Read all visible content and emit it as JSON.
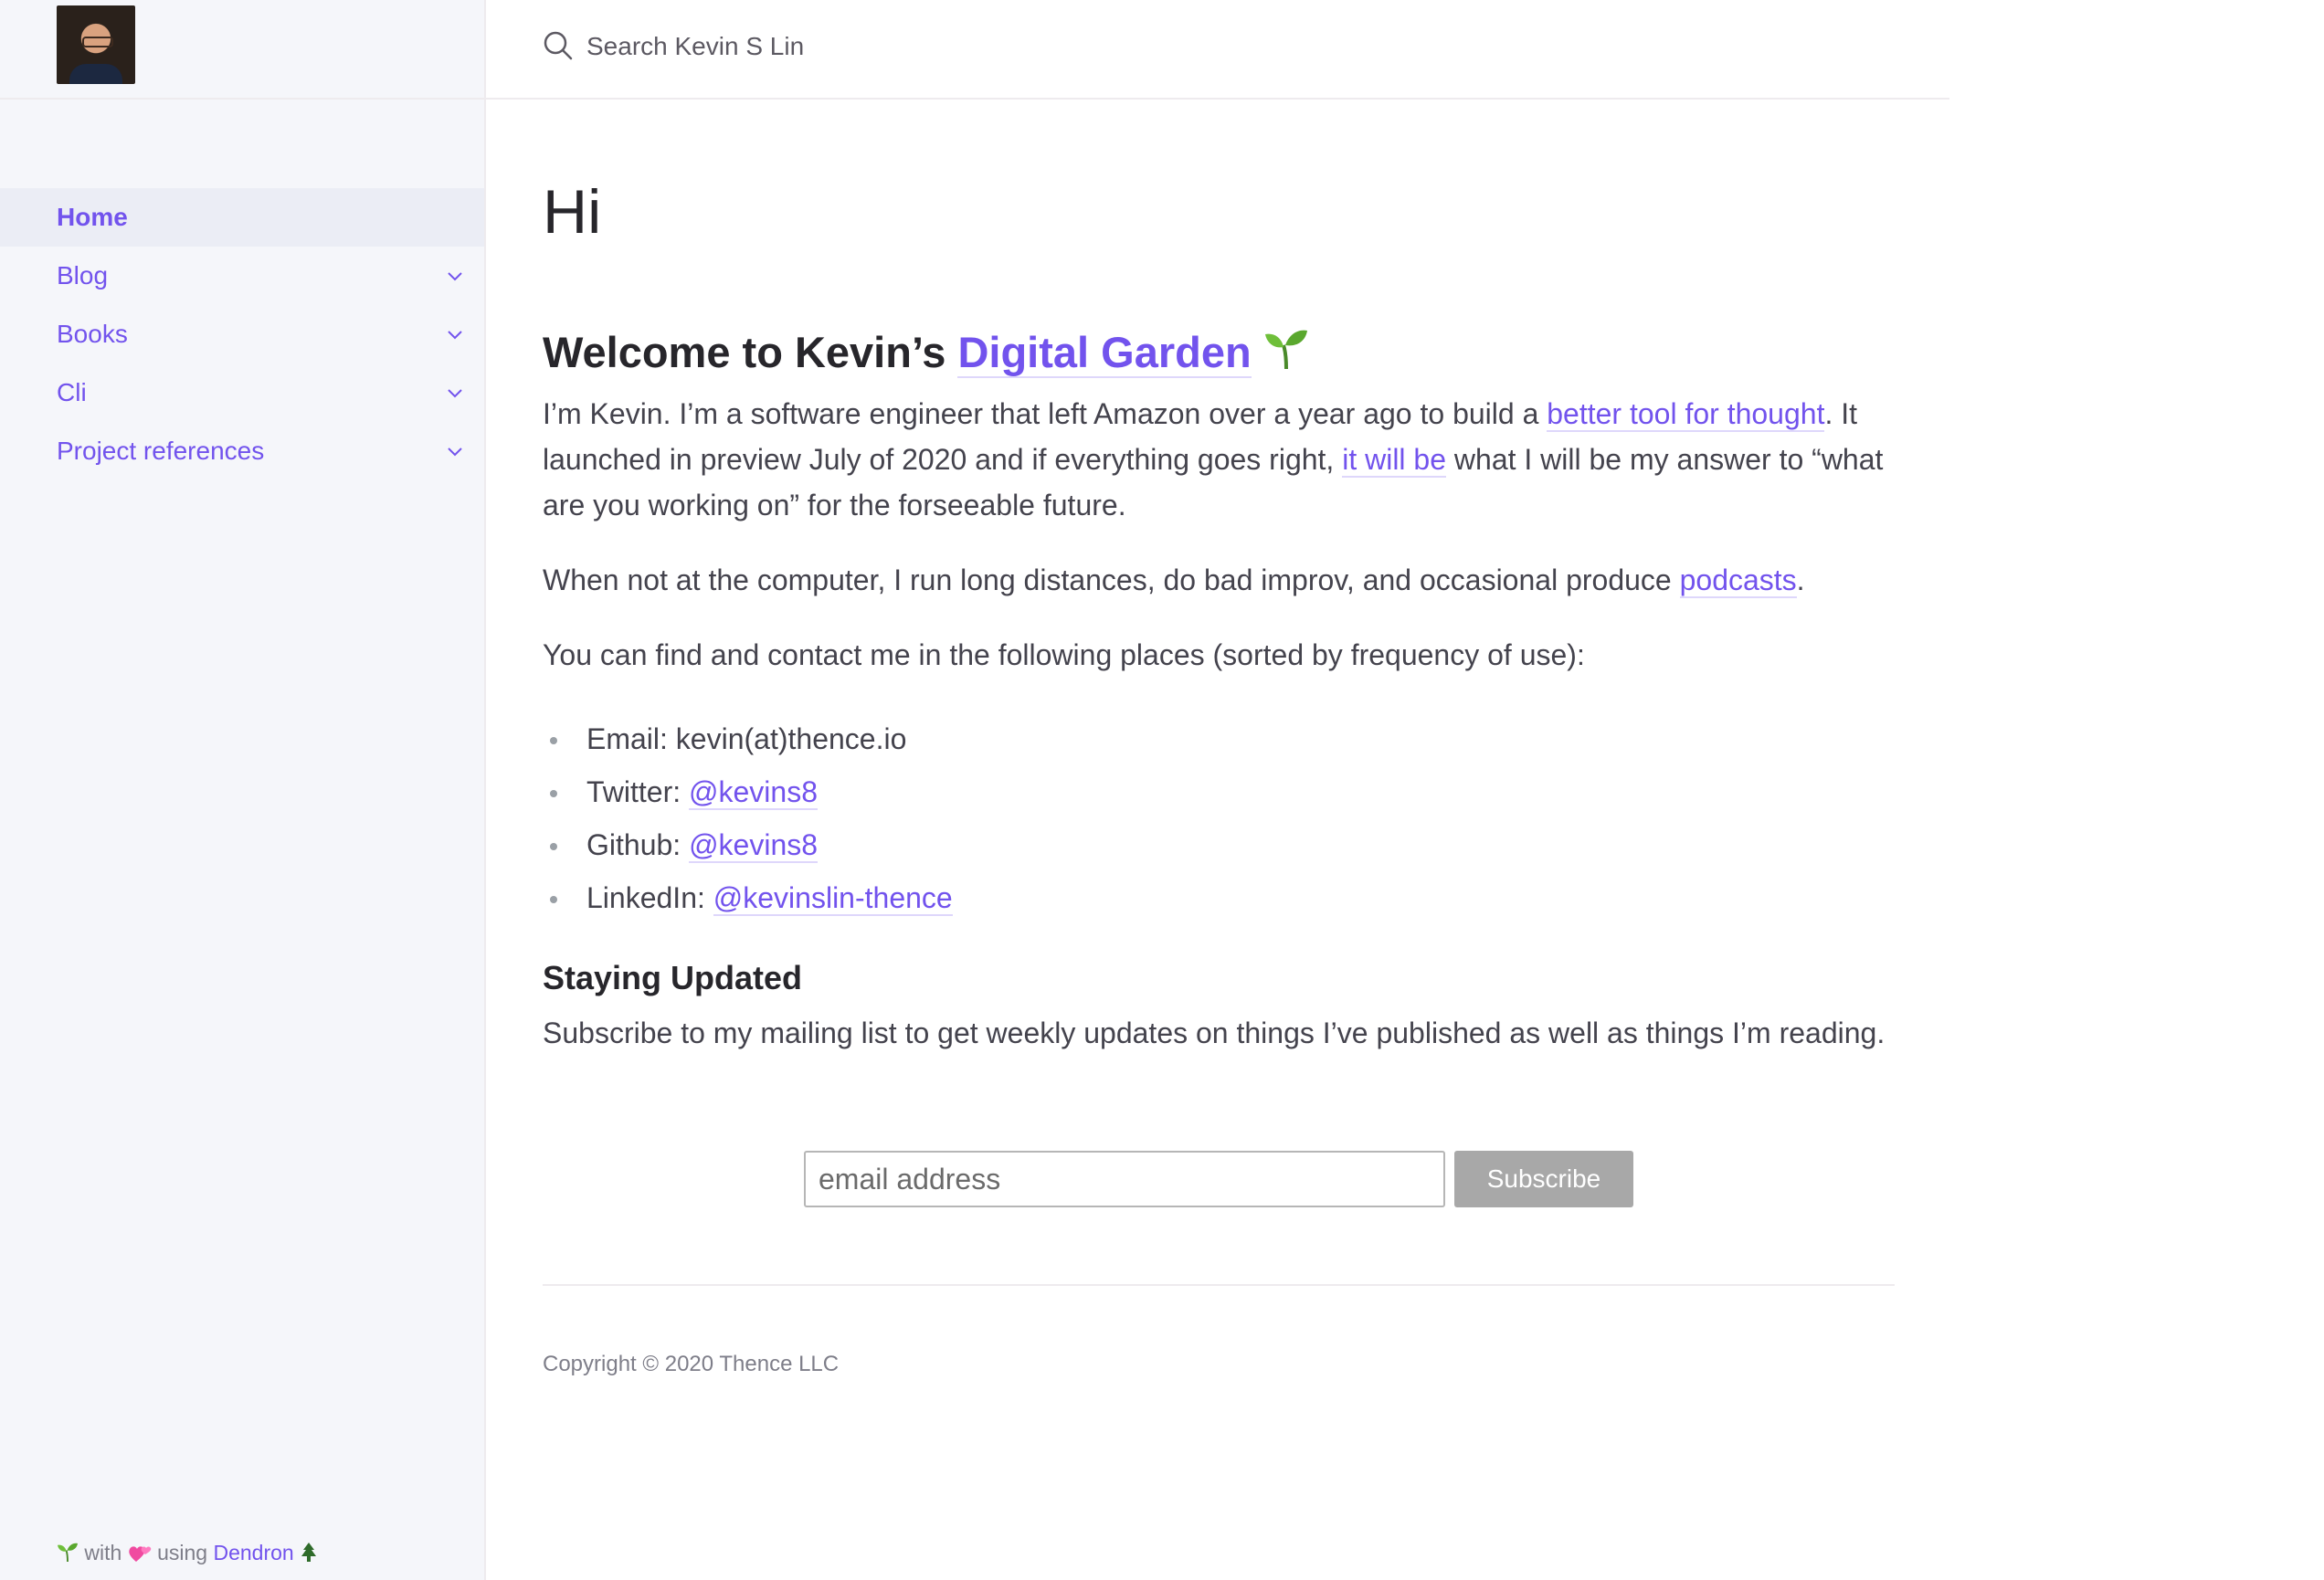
{
  "sidebar": {
    "nav": [
      {
        "label": "Home",
        "active": true
      },
      {
        "label": "Blog"
      },
      {
        "label": "Books"
      },
      {
        "label": "Cli"
      },
      {
        "label": "Project references"
      }
    ],
    "footer": {
      "part1": " with ",
      "part2": " using ",
      "brand": "Dendron"
    }
  },
  "search": {
    "placeholder": "Search Kevin S Lin"
  },
  "main": {
    "title": "Hi",
    "welcome": {
      "prefix": "Welcome to Kevin’s ",
      "link": "Digital Garden"
    },
    "intro": {
      "t1": "I’m Kevin. I’m a software engineer that left Amazon over a year ago to build a ",
      "link1": "better tool for thought",
      "t2": ". It launched in preview July of 2020 and if everything goes right, ",
      "link2": "it will be",
      "t3": " what I will be my answer to “what are you working on” for the forseeable future."
    },
    "hobbies": {
      "text": "When not at the computer, I run long distances, do bad improv, and occasional produce ",
      "link": "podcasts",
      "end": "."
    },
    "contact_intro": "You can find and contact me in the following places (sorted by frequency of use):",
    "contacts": [
      {
        "label": "Email: ",
        "value": "kevin(at)thence.io"
      },
      {
        "label": "Twitter: ",
        "link": "@kevins8"
      },
      {
        "label": "Github: ",
        "link": "@kevins8"
      },
      {
        "label": "LinkedIn: ",
        "link": "@kevinslin-thence"
      }
    ],
    "updated_title": "Staying Updated",
    "updated_text": "Subscribe to my mailing list to get weekly updates on things I’ve published as well as things I’m reading.",
    "email_placeholder": "email address",
    "subscribe_label": "Subscribe",
    "copyright": "Copyright © 2020 Thence LLC"
  },
  "colors": {
    "accent": "#7253ed",
    "heading": "#27262b",
    "body": "#44434d",
    "sidebar_bg": "#f5f6fa"
  },
  "icons": [
    "search-icon",
    "chevron-down-icon",
    "seedling-icon",
    "two-hearts-icon",
    "evergreen-tree-icon"
  ]
}
